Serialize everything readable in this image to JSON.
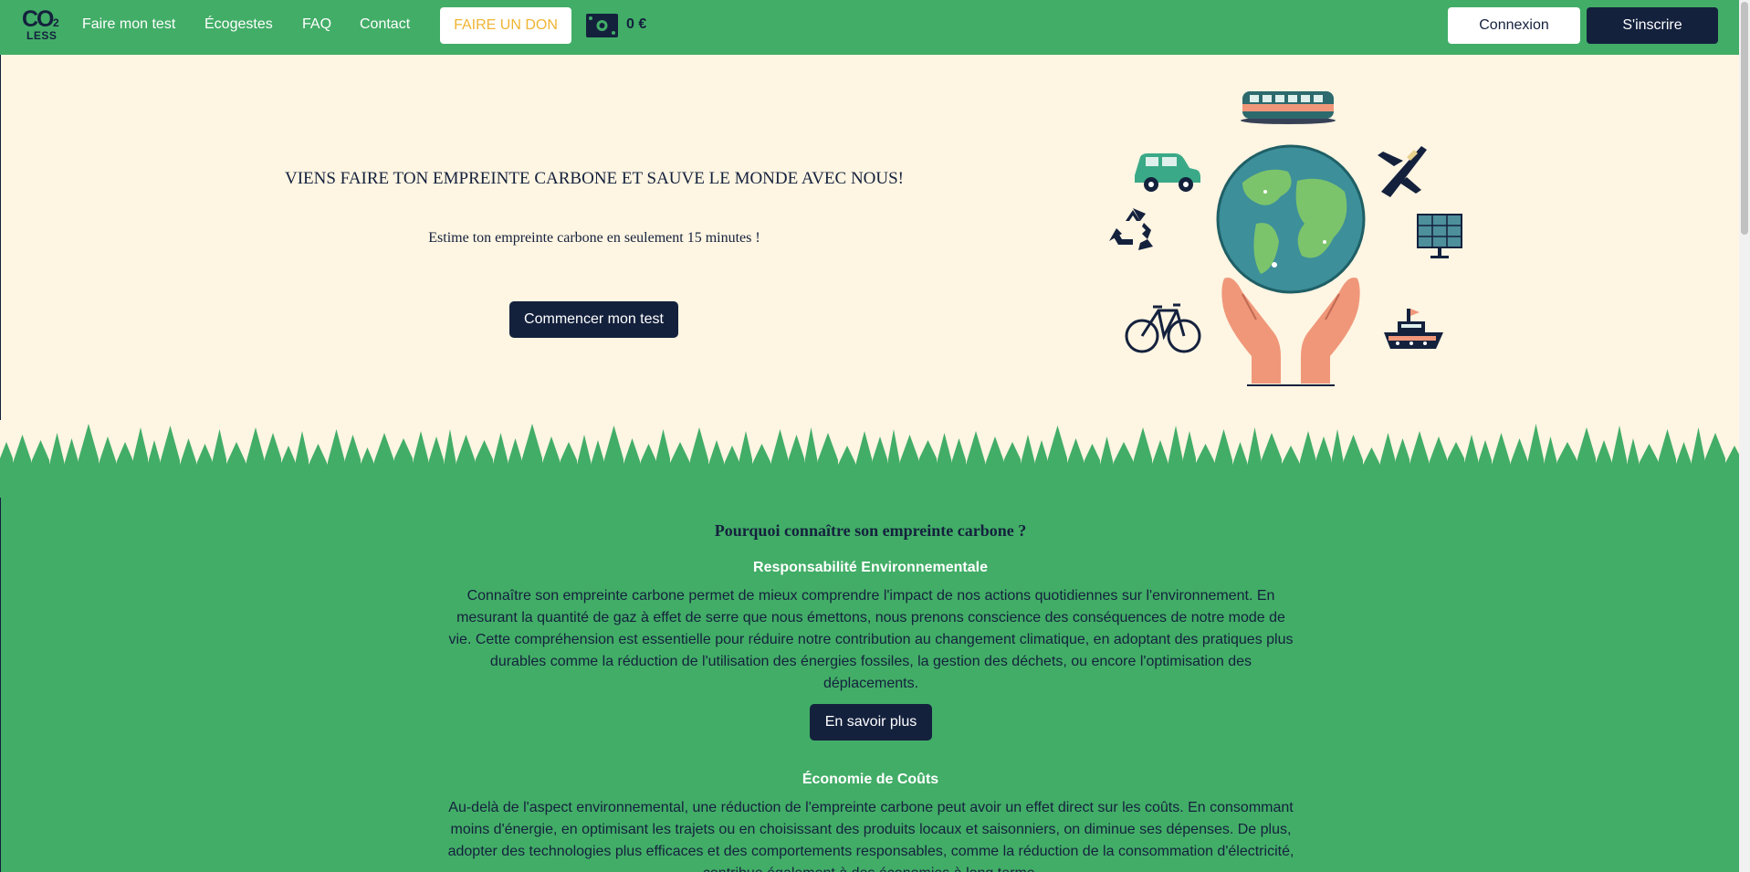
{
  "nav": {
    "logo_co": "CO",
    "logo_two": "2",
    "logo_less": "LESS",
    "links": [
      "Faire mon test",
      "Écogestes",
      "FAQ",
      "Contact"
    ],
    "donate_label": "FAIRE UN DON",
    "money_icon": "banknote-icon",
    "money_amount": "0 €",
    "login_label": "Connexion",
    "signup_label": "S'inscrire"
  },
  "hero": {
    "title": "VIENS FAIRE TON EMPREINTE CARBONE ET SAUVE LE MONDE AVEC NOUS!",
    "subtitle": "Estime ton empreinte carbone en seulement 15 minutes !",
    "cta_label": "Commencer mon test",
    "illustration_icons": [
      "train-icon",
      "car-icon",
      "plane-icon",
      "recycle-icon",
      "earth-icon",
      "hands-icon",
      "solar-panel-icon",
      "bicycle-icon",
      "boat-icon"
    ]
  },
  "content": {
    "why_title": "Pourquoi connaître son empreinte carbone ?",
    "sections": [
      {
        "title": "Responsabilité Environnementale",
        "text": "Connaître son empreinte carbone permet de mieux comprendre l'impact de nos actions quotidiennes sur l'environnement. En mesurant la quantité de gaz à effet de serre que nous émettons, nous prenons conscience des conséquences de notre mode de vie. Cette compréhension est essentielle pour réduire notre contribution au changement climatique, en adoptant des pratiques plus durables comme la réduction de l'utilisation des énergies fossiles, la gestion des déchets, ou encore l'optimisation des déplacements.",
        "button_label": "En savoir plus"
      },
      {
        "title": "Économie de Coûts",
        "text": "Au-delà de l'aspect environnemental, une réduction de l'empreinte carbone peut avoir un effet direct sur les coûts. En consommant moins d'énergie, en optimisant les trajets ou en choisissant des produits locaux et saisonniers, on diminue ses dépenses. De plus, adopter des technologies plus efficaces et des comportements responsables, comme la réduction de la consommation d'électricité, contribue également à des économies à long terme."
      }
    ]
  },
  "colors": {
    "green": "#42ad67",
    "navy": "#14213d",
    "cream": "#fef5e2",
    "donate_text": "#f0b433"
  }
}
